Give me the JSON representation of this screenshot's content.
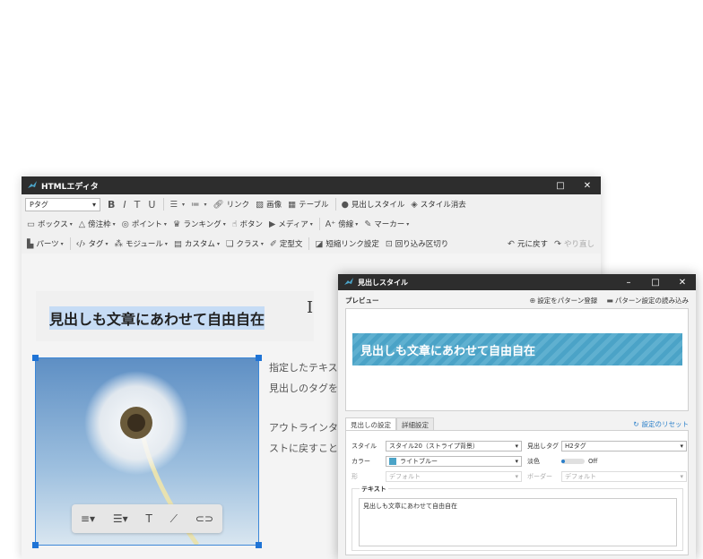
{
  "editor": {
    "title": "HTMLエディタ",
    "toolbar": {
      "row1": {
        "tag_select": "Pタグ",
        "bold": "B",
        "italic": "I",
        "strike": "T",
        "underline": "U",
        "link": "リンク",
        "image": "画像",
        "table": "テーブル",
        "heading_style": "見出しスタイル",
        "clear_style": "スタイル消去"
      },
      "row2": {
        "box": "ボックス",
        "bullet": "傍注枠",
        "point": "ポイント",
        "ranking": "ランキング",
        "button": "ボタン",
        "media": "メディア",
        "accent": "傍線",
        "marker": "マーカー"
      },
      "row3": {
        "parts": "パーツ",
        "tag": "タグ",
        "module": "モジュール",
        "custom": "カスタム",
        "class": "クラス",
        "fixed_text": "定型文",
        "shortcode": "短縮リンク設定",
        "wrap": "回り込み区切り",
        "undo": "元に戻す",
        "redo": "やり直し"
      }
    },
    "content": {
      "heading": "見出しも文章にあわせて自由自在",
      "para1_line1": "指定したテキス",
      "para1_line2": "見出しのタグを",
      "para2_line1": "アウトラインタ",
      "para2_line2": "ストに戻すこと"
    }
  },
  "dialog": {
    "title": "見出しスタイル",
    "preview_label": "プレビュー",
    "save_pattern": "設定をパターン登録",
    "load_pattern": "パターン設定の読み込み",
    "preview_text": "見出しも文章にあわせて自由自在",
    "tabs": [
      "見出しの設定",
      "詳細設定"
    ],
    "reset": "設定のリセット",
    "fields": {
      "style_label": "スタイル",
      "style_value": "スタイル20（ストライプ背景）",
      "htag_label": "見出しタグ",
      "htag_value": "H2タグ",
      "color_label": "カラー",
      "color_value": "ライトブルー",
      "light_label": "淡色",
      "light_value": "Off",
      "shape_label": "形",
      "shape_value": "デフォルト",
      "border_label": "ボーダー",
      "border_value": "デフォルト"
    },
    "text_label": "テキスト",
    "text_value": "見出しも文章にあわせて自由自在"
  },
  "colors": {
    "titlebar": "#2d2d2d",
    "accent_blue": "#4ba3c7",
    "selection": "#c6dcf5"
  }
}
